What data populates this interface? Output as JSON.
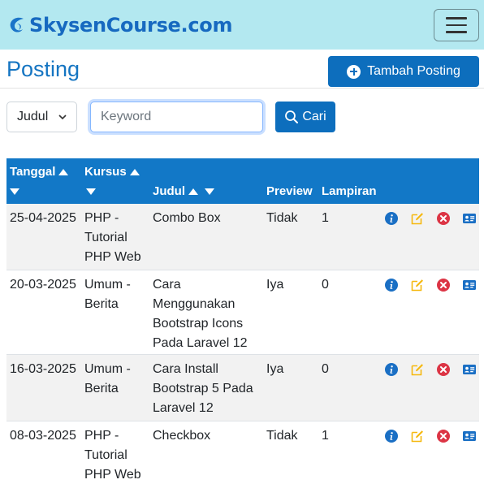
{
  "navbar": {
    "brand": "SkysenCourse.com",
    "logo_icon": "swirl-logo-icon",
    "toggler_icon": "hamburger-menu-icon"
  },
  "header": {
    "title": "Posting",
    "add_button": "Tambah Posting",
    "add_icon": "plus-circle-icon"
  },
  "filter": {
    "field_select": "Judul",
    "keyword_placeholder": "Keyword",
    "keyword_value": "",
    "search_button": "Cari",
    "search_icon": "search-icon"
  },
  "table": {
    "columns": [
      "Tanggal",
      "Kursus",
      "Judul",
      "Preview",
      "Lampiran"
    ],
    "rows": [
      {
        "tanggal": "25-04-2025",
        "kursus": "PHP - Tutorial PHP Web",
        "judul": "Combo Box",
        "preview": "Tidak",
        "lampiran": "1"
      },
      {
        "tanggal": "20-03-2025",
        "kursus": "Umum - Berita",
        "judul": "Cara Menggunakan Bootstrap Icons Pada Laravel 12",
        "preview": "Iya",
        "lampiran": "0"
      },
      {
        "tanggal": "16-03-2025",
        "kursus": "Umum - Berita",
        "judul": "Cara Install Bootstrap 5 Pada Laravel 12",
        "preview": "Iya",
        "lampiran": "0"
      },
      {
        "tanggal": "08-03-2025",
        "kursus": "PHP - Tutorial PHP Web",
        "judul": "Checkbox",
        "preview": "Tidak",
        "lampiran": "1"
      }
    ],
    "action_icons": [
      "info-icon",
      "edit-icon",
      "delete-icon",
      "id-card-icon"
    ]
  },
  "colors": {
    "navbar_bg": "#b3e8f0",
    "brand": "#1669c0",
    "primary": "#0d6ebd",
    "table_header": "#1278c7",
    "info": "#1a6fc4",
    "edit": "#f5b80f",
    "delete": "#dc3545"
  }
}
